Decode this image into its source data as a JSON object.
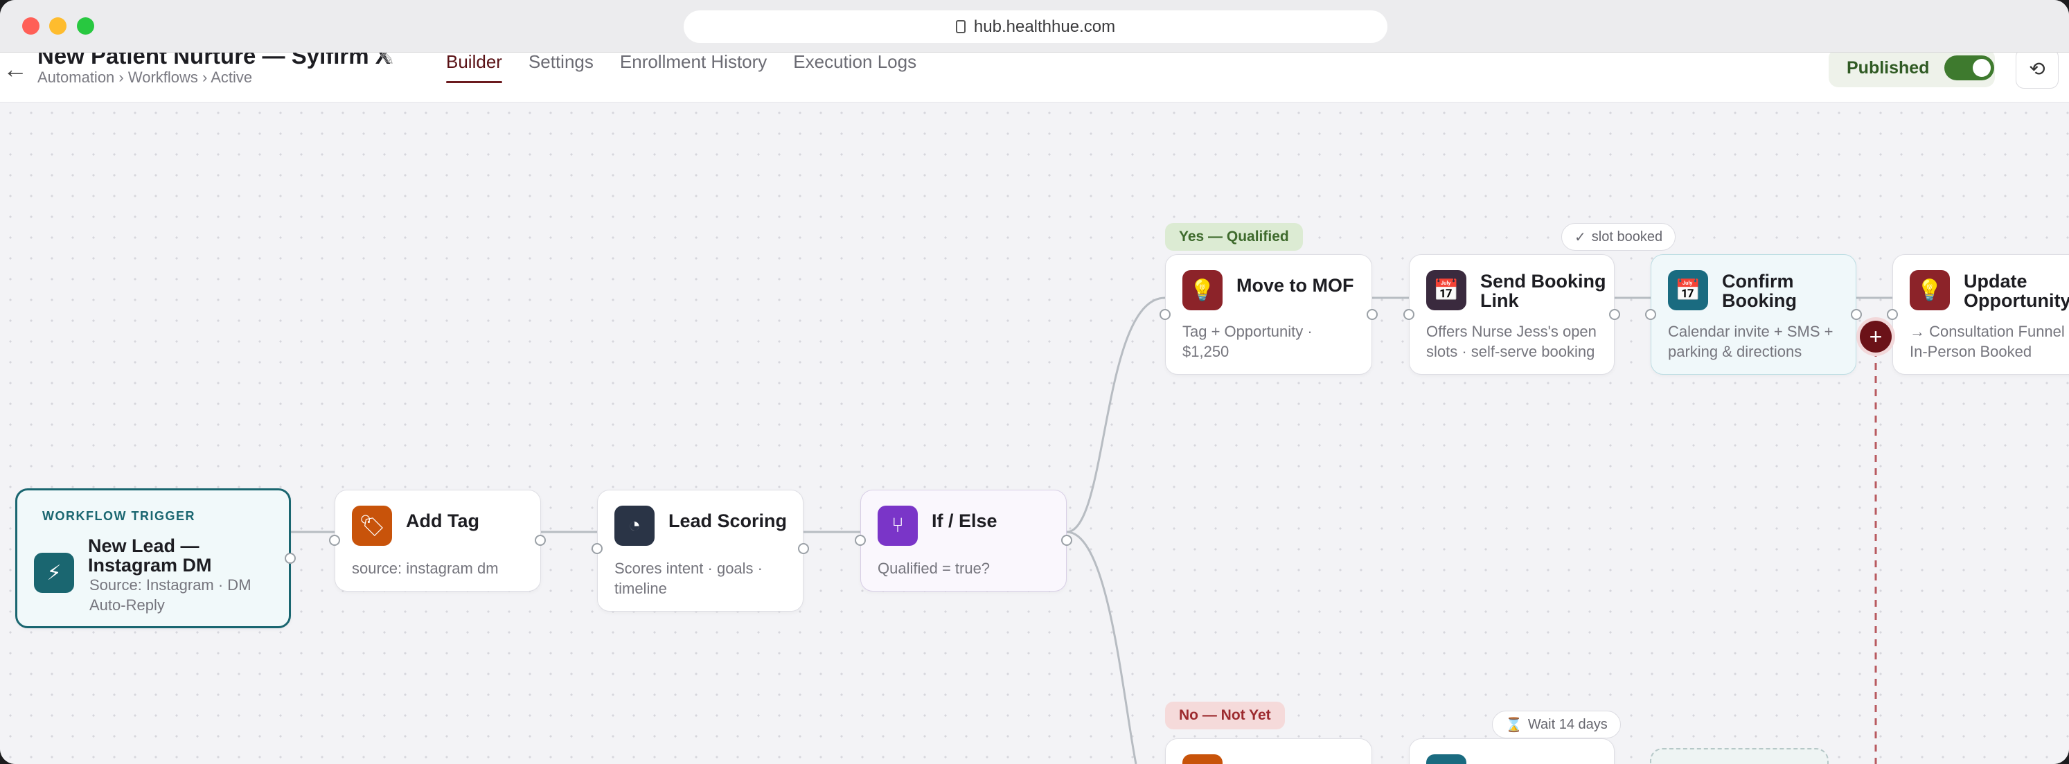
{
  "browser": {
    "url": "hub.healthhue.com"
  },
  "header": {
    "title": "New Patient Nurture — Sylfirm X",
    "breadcrumb": "Automation › Workflows › Active",
    "tabs": [
      "Builder",
      "Settings",
      "Enrollment History",
      "Execution Logs"
    ],
    "active_tab": "Builder",
    "publish_label": "Published",
    "published": true
  },
  "trigger": {
    "caption": "WORKFLOW TRIGGER",
    "title": "New Lead — Instagram DM",
    "desc": "Source: Instagram · DM Auto-Reply",
    "icon": "lightning-icon"
  },
  "nodes": {
    "add_tag": {
      "title": "Add Tag",
      "desc": "source: instagram dm",
      "icon": "tag-icon",
      "color": "#c8530a"
    },
    "lead_scoring": {
      "title": "Lead Scoring",
      "desc": "Scores intent · goals · timeline",
      "icon": "gauge-icon",
      "color": "#2a3446"
    },
    "if_else": {
      "title": "If / Else",
      "desc": "Qualified = true?",
      "icon": "branch-icon",
      "color": "#7a35c8"
    },
    "move_mof": {
      "title": "Move to MOF",
      "desc": "Tag + Opportunity · $1,250",
      "icon": "lightbulb-icon",
      "color": "#8c2329"
    },
    "send_booking": {
      "title": "Send Booking Link",
      "desc": "Offers Nurse Jess's open slots · self-serve booking",
      "icon": "calendar-check-icon",
      "color": "#3a2a3e"
    },
    "confirm_booking": {
      "title": "Confirm Booking",
      "desc": "Calendar invite + SMS + parking & directions",
      "icon": "calendar-check-icon",
      "color": "#1a6b80"
    },
    "update_opportunity": {
      "title": "Update Opportunity",
      "desc": "→ Consultation Funnel In-Person Booked",
      "icon": "lightbulb-icon",
      "color": "#8c2329"
    }
  },
  "branches": {
    "yes": "Yes — Qualified",
    "no": "No — Not Yet"
  },
  "chips": {
    "slot_booked": "slot booked",
    "wait": "Wait 14 days"
  },
  "colors": {
    "accent": "#6b1a1e",
    "trigger": "#1a6670",
    "published_green": "#3e7a2e"
  }
}
